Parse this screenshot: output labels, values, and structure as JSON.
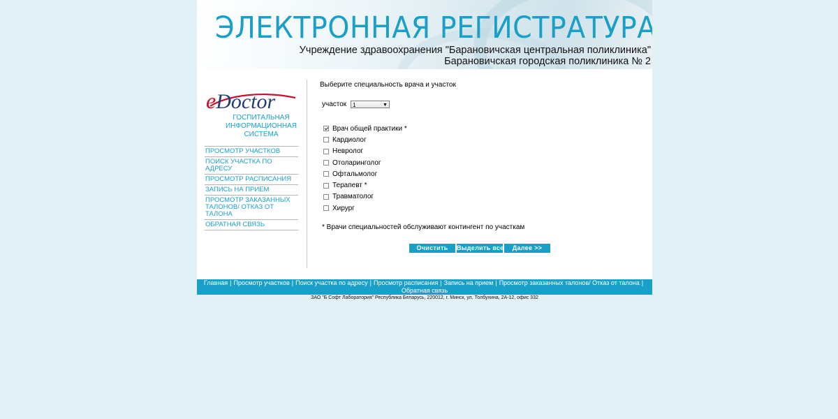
{
  "banner": {
    "title": "ЭЛЕКТРОННАЯ РЕГИСТРАТУРА",
    "subtitle": "Учреждение здравоохранения \"Барановичская центральная поликлиника\" Барановичская городская поликлиника № 2"
  },
  "logo": {
    "e": "e",
    "word": "Doctor",
    "caption": "ГОСПИТАЛЬНАЯ ИНФОРМАЦИОННАЯ СИСТЕМА"
  },
  "sidebar": {
    "items": [
      {
        "label": "ПРОСМОТР УЧАСТКОВ"
      },
      {
        "label": "ПОИСК УЧАСТКА ПО АДРЕСУ"
      },
      {
        "label": "ПРОСМОТР РАСПИСАНИЯ"
      },
      {
        "label": "ЗАПИСЬ НА ПРИЕМ"
      },
      {
        "label": "ПРОСМОТР ЗАКАЗАННЫХ ТАЛОНОВ/ ОТКАЗ ОТ ТАЛОНА"
      },
      {
        "label": "ОБРАТНАЯ СВЯЗЬ"
      }
    ]
  },
  "main": {
    "prompt": "Выберите специальность врача и участок",
    "district_label": "участок",
    "district_value": "1",
    "specialties": [
      {
        "label": "Врач общей практики *",
        "checked": true
      },
      {
        "label": "Кардиолог",
        "checked": false
      },
      {
        "label": "Невролог",
        "checked": false
      },
      {
        "label": "Отоларинголог",
        "checked": false
      },
      {
        "label": "Офтальмолог",
        "checked": false
      },
      {
        "label": "Терапевт *",
        "checked": false
      },
      {
        "label": "Травматолог",
        "checked": false
      },
      {
        "label": "Хирург",
        "checked": false
      }
    ],
    "note": "* Врачи специальностей обслуживают контингент по участкам",
    "buttons": {
      "clear": "Очистить",
      "select_all": "Выделить все",
      "next": "Далее >>"
    }
  },
  "footer": {
    "nav": [
      {
        "label": "Главная"
      },
      {
        "label": "Просмотр участков"
      },
      {
        "label": "Поиск участка по адресу"
      },
      {
        "label": "Просмотр расписания"
      },
      {
        "label": "Запись на прием"
      },
      {
        "label": "Просмотр заказанных талонов/ Отказ от талона"
      },
      {
        "label": "Обратная связь"
      }
    ],
    "separator": "|",
    "copyright": "ЗАО \"Б Софт Лаборатория\" Республика Беларусь, 220012, г. Минск, ул. Толбухина, 2А-12, офис 332"
  },
  "colors": {
    "accent": "#1aa0c8",
    "background": "#e2f1f6",
    "logo_blue": "#233b78",
    "logo_red": "#c8102e"
  }
}
